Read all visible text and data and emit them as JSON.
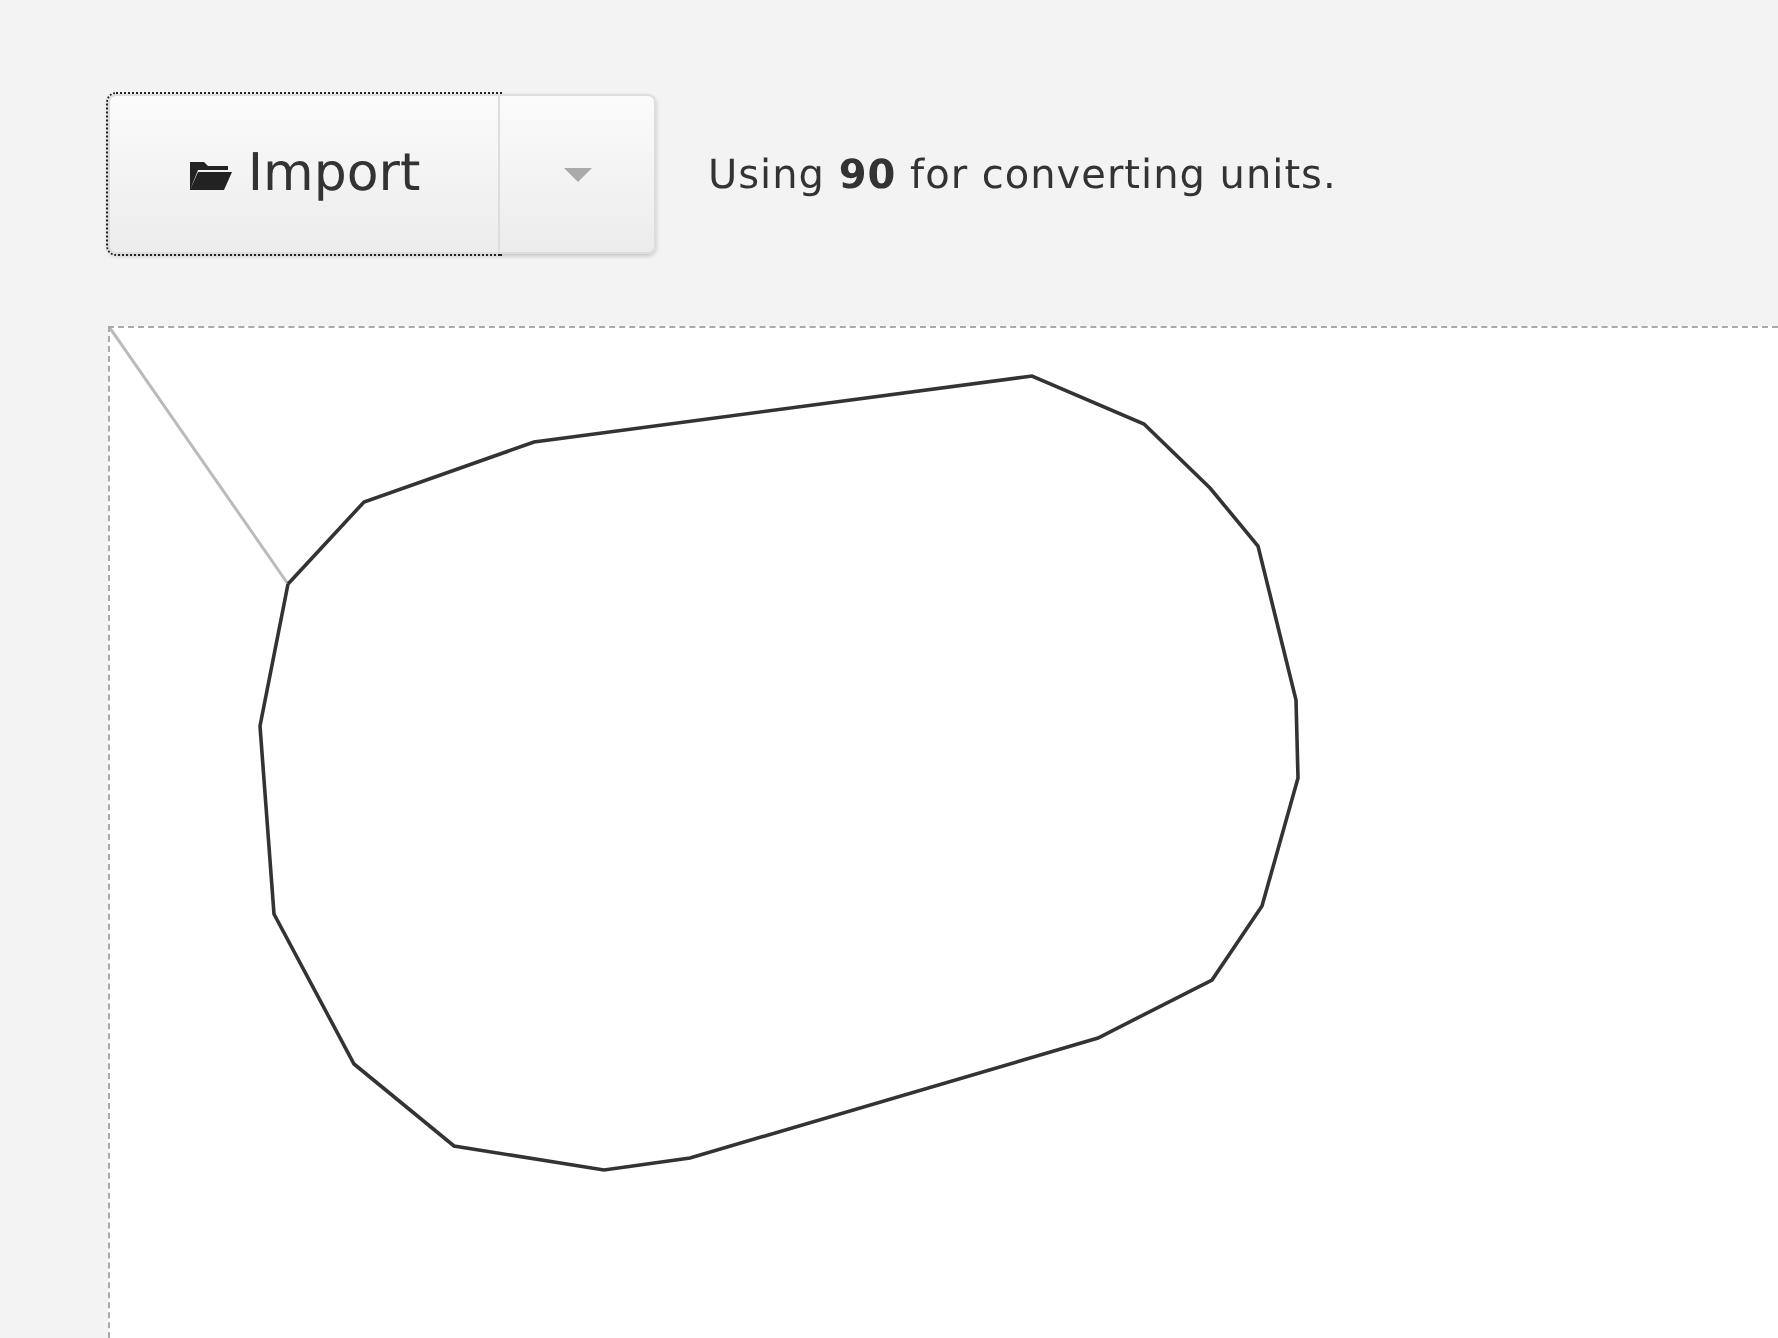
{
  "toolbar": {
    "import_button": {
      "label": "Import"
    },
    "info": "Using **90** for converting units."
  }
}
